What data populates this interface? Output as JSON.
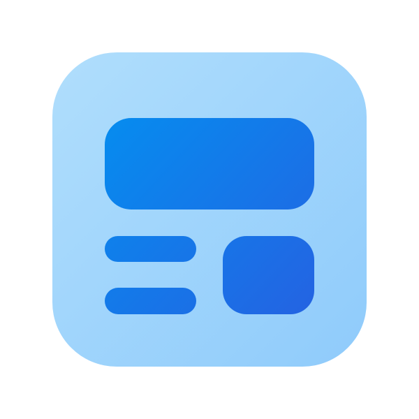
{
  "icon": {
    "name": "layout-dashboard-icon",
    "colors": {
      "tile_light": "#B0DEFC",
      "tile_dark": "#8FCBFB",
      "blocks_start": "#068CEF",
      "blocks_end": "#2463E2",
      "background": "#FFFFFF"
    }
  }
}
